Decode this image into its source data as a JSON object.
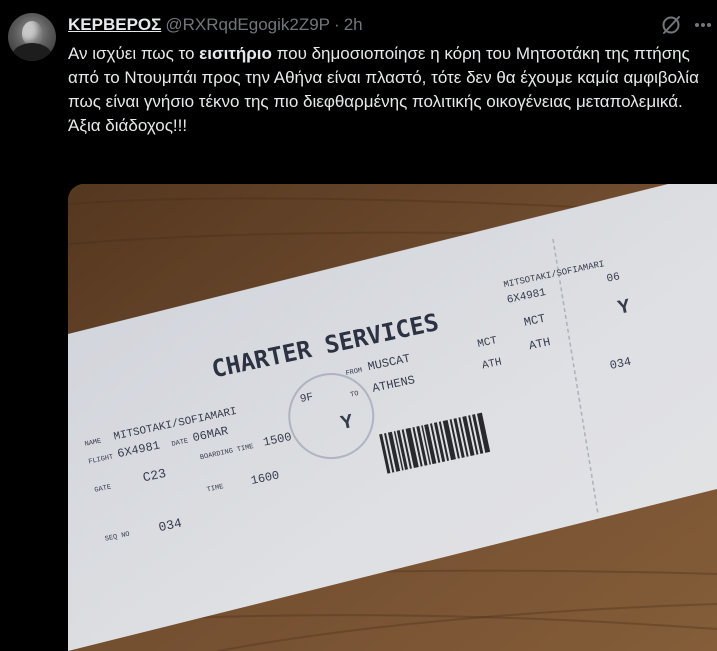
{
  "tweet": {
    "display_name": "ΚΕΡΒΕΡΟΣ",
    "handle": "@RXRqdEgogik2Z9P",
    "separator": "·",
    "time": "2h",
    "text_before_bold": "Αν ισχύει πως το ",
    "bold_word": "εισιτήριο",
    "text_after_bold": " που δημοσιοποίησε η κόρη του Μητσοτάκη της πτήσης από το Ντουμπάι προς την Αθήνα είναι πλαστό, τότε δεν θα έχουμε καμία αμφιβολία πως είναι γνήσιο τέκνο της πιο διεφθαρμένης πολιτικής οικογένειας μεταπολεμικά.",
    "second_line": "Άξια διάδοχος!!!"
  },
  "icons": {
    "grok": "grok-slash-circle-icon",
    "more": "more-horizontal-icon"
  },
  "colors": {
    "background": "#000000",
    "primary_text": "#e7e9ea",
    "secondary_text": "#71767b"
  },
  "ticket": {
    "title": "CHARTER SERVICES",
    "passenger_label": "NAME",
    "passenger": "MITSOTAKI/SOFIAMARI",
    "flight_label": "FLIGHT",
    "flight": "6X4981",
    "date_label": "DATE",
    "date": "06MAR",
    "seat_main": "9F",
    "from_label": "FROM",
    "from_city": "MUSCAT",
    "from_code": "MCT",
    "to_label": "TO",
    "to_city": "ATHENS",
    "to_code": "ATH",
    "gate_label": "GATE",
    "gate": "C23",
    "boarding_label": "BOARDING TIME",
    "boarding_time": "1500",
    "time_label": "TIME",
    "time": "1600",
    "class": "Y",
    "seq_label": "SEQ NO",
    "seq": "034",
    "stub_name": "MITSOTAKI/SOFIAMARI",
    "stub_flight": "6X4981",
    "stub_date": "06",
    "stub_from": "MCT",
    "stub_to": "ATH",
    "stub_class": "Y",
    "stub_seq": "034"
  }
}
